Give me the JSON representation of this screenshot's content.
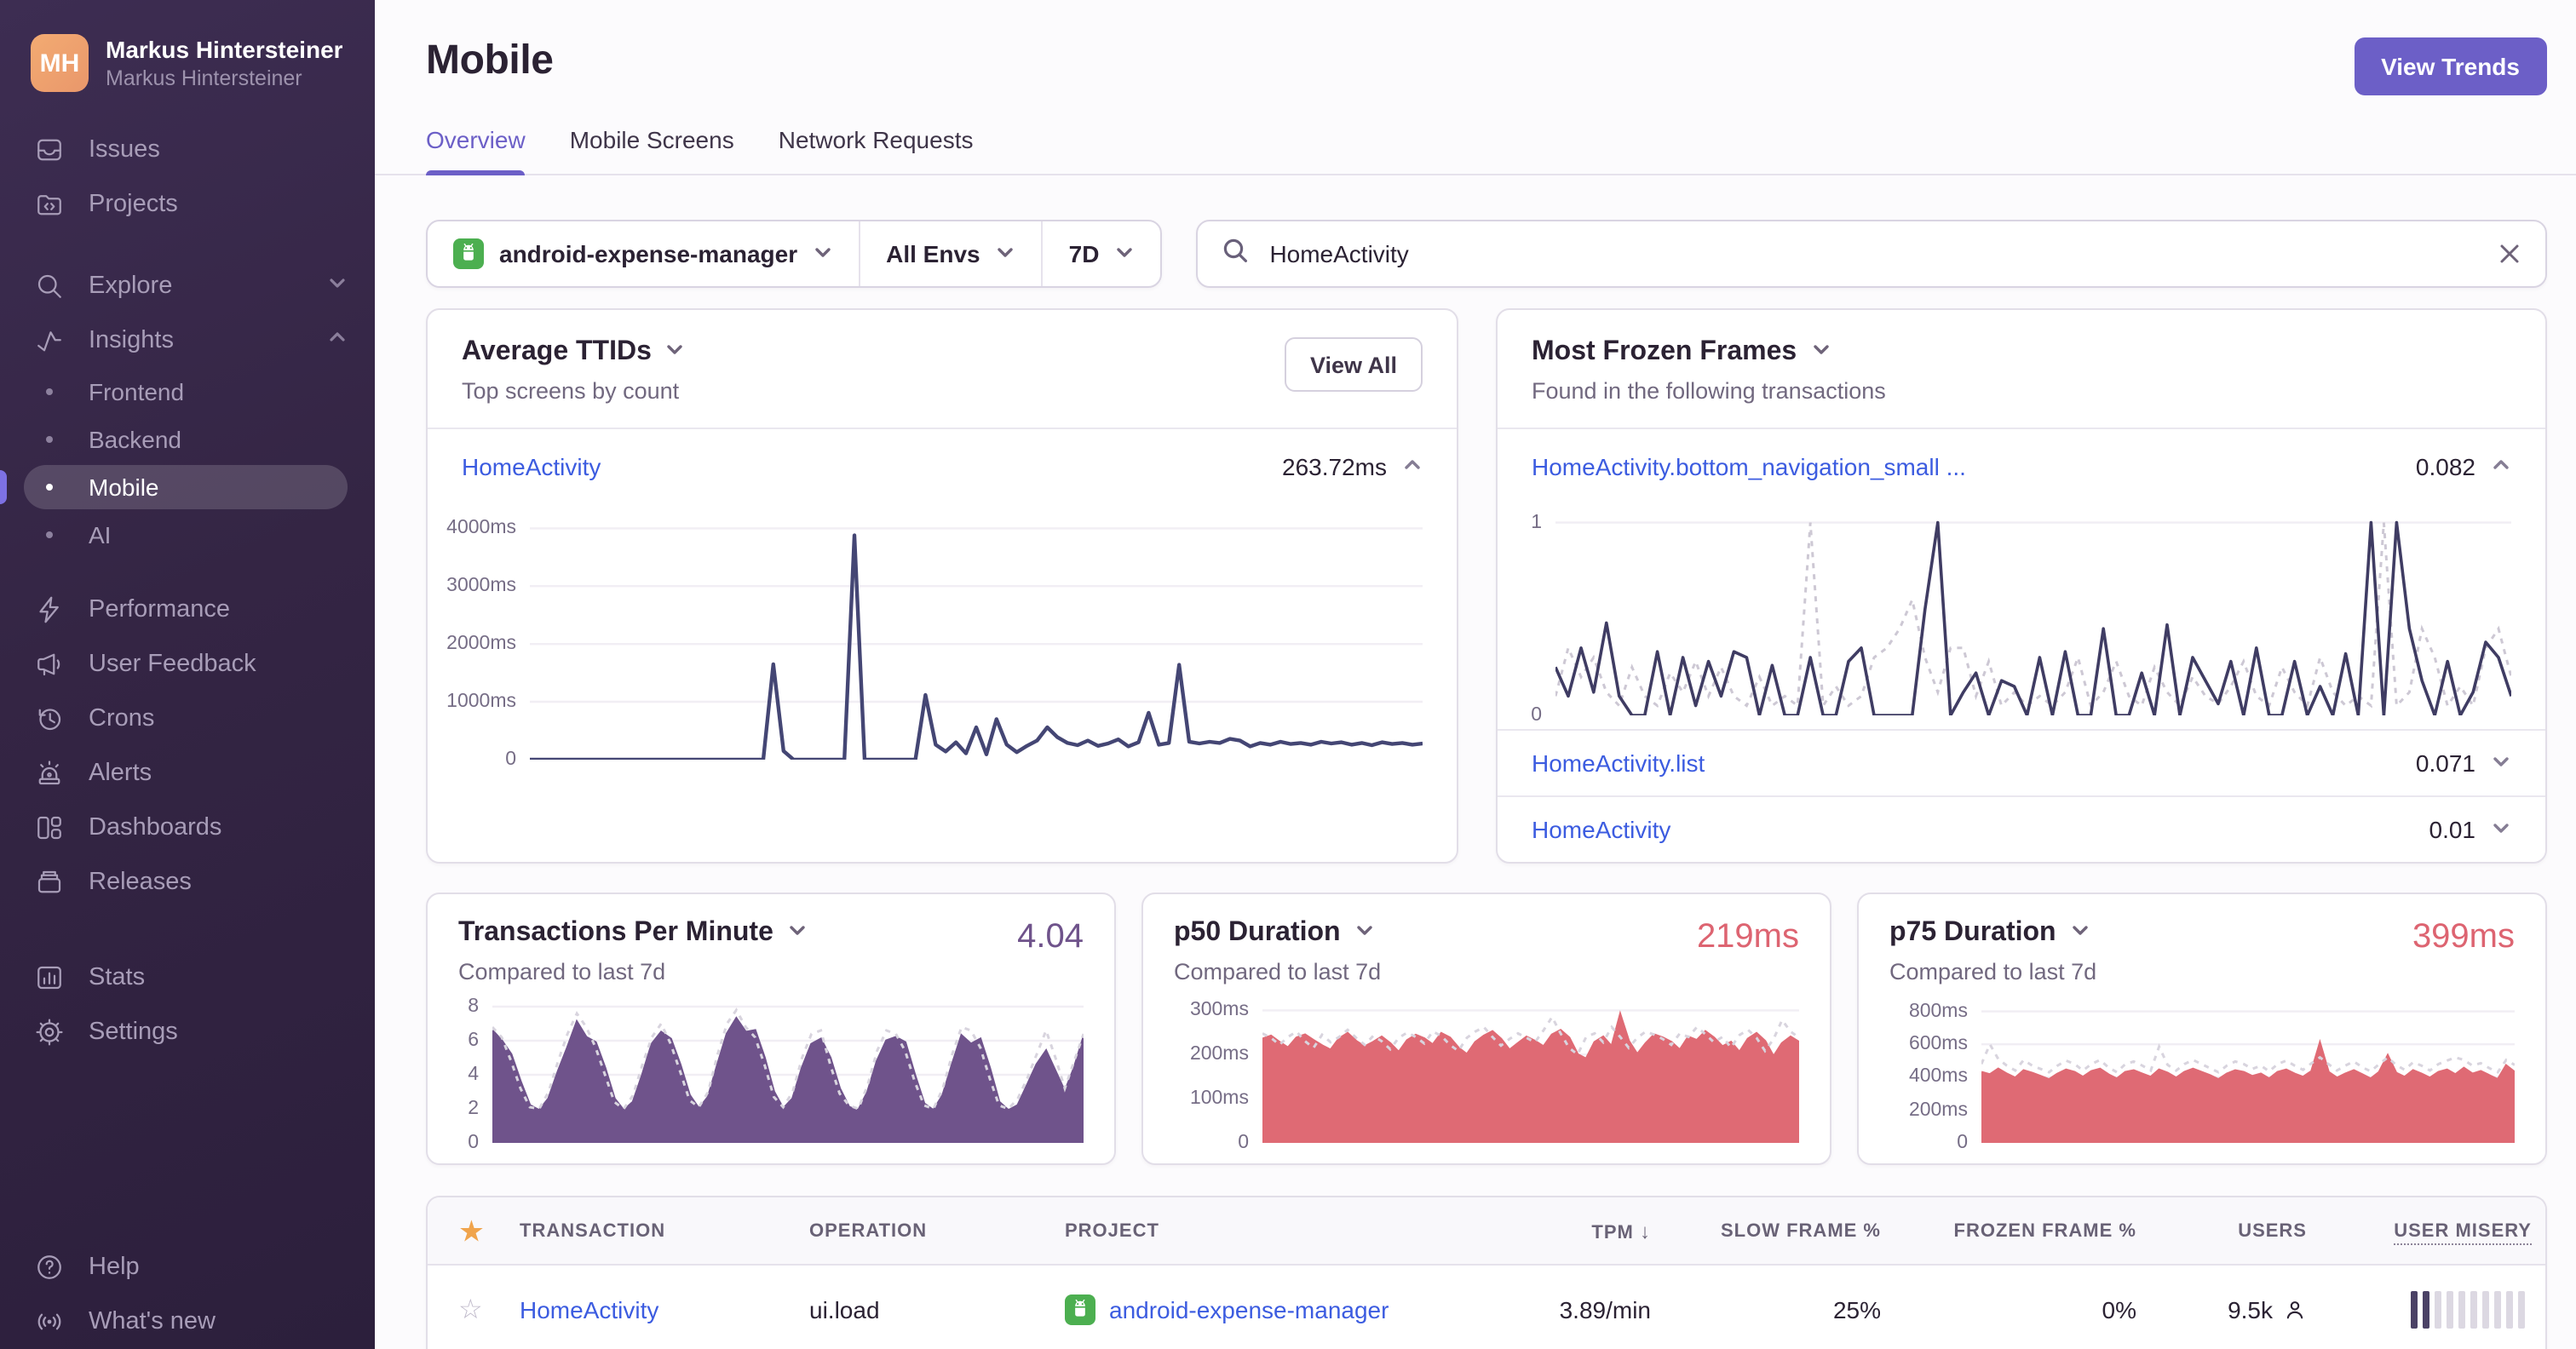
{
  "sidebar": {
    "avatar_initials": "MH",
    "org_name": "Markus Hintersteiner",
    "user_name": "Markus Hintersteiner",
    "items": [
      {
        "label": "Issues"
      },
      {
        "label": "Projects"
      },
      {
        "label": "Explore"
      },
      {
        "label": "Insights"
      },
      {
        "label": "Frontend"
      },
      {
        "label": "Backend"
      },
      {
        "label": "Mobile",
        "active": true
      },
      {
        "label": "AI"
      },
      {
        "label": "Performance"
      },
      {
        "label": "User Feedback"
      },
      {
        "label": "Crons"
      },
      {
        "label": "Alerts"
      },
      {
        "label": "Dashboards"
      },
      {
        "label": "Releases"
      },
      {
        "label": "Stats"
      },
      {
        "label": "Settings"
      },
      {
        "label": "Help"
      },
      {
        "label": "What's new"
      }
    ]
  },
  "header": {
    "title": "Mobile",
    "view_trends_label": "View Trends",
    "tabs": [
      {
        "label": "Overview",
        "active": true
      },
      {
        "label": "Mobile Screens"
      },
      {
        "label": "Network Requests"
      }
    ]
  },
  "filters": {
    "project": "android-expense-manager",
    "environment": "All Envs",
    "date_range": "7D",
    "search_value": "HomeActivity"
  },
  "cards": {
    "average_ttids": {
      "title": "Average TTIDs",
      "subtitle": "Top screens by count",
      "view_all_label": "View All",
      "rows": [
        {
          "name": "HomeActivity",
          "value": "263.72ms",
          "expanded": true
        }
      ]
    },
    "most_frozen_frames": {
      "title": "Most Frozen Frames",
      "subtitle": "Found in the following transactions",
      "rows": [
        {
          "name": "HomeActivity.bottom_navigation_small ...",
          "value": "0.082",
          "expanded": true
        },
        {
          "name": "HomeActivity.list",
          "value": "0.071",
          "expanded": false
        },
        {
          "name": "HomeActivity",
          "value": "0.01",
          "expanded": false
        }
      ]
    },
    "tpm": {
      "title": "Transactions Per Minute",
      "subtitle": "Compared to last 7d",
      "value": "4.04",
      "accent_color": "#6f538b"
    },
    "p50": {
      "title": "p50 Duration",
      "subtitle": "Compared to last 7d",
      "value": "219ms",
      "accent_color": "#dd6471"
    },
    "p75": {
      "title": "p75 Duration",
      "subtitle": "Compared to last 7d",
      "value": "399ms",
      "accent_color": "#dd6471"
    }
  },
  "table": {
    "columns": [
      "TRANSACTION",
      "OPERATION",
      "PROJECT",
      "TPM",
      "SLOW FRAME %",
      "FROZEN FRAME %",
      "USERS",
      "USER MISERY"
    ],
    "sorted_column": "TPM",
    "sort_direction": "desc",
    "row": {
      "transaction": "HomeActivity",
      "operation": "ui.load",
      "project": "android-expense-manager",
      "tpm": "3.89/min",
      "slow_frame_pct": "25%",
      "frozen_frame_pct": "0%",
      "users": "9.5k",
      "misery_filled": 2,
      "misery_total": 10
    }
  },
  "chart_data": [
    {
      "id": "ttid",
      "type": "line",
      "title": "Average TTIDs - HomeActivity",
      "ylabel": "ms",
      "color": "#444674",
      "line_width": 2.2,
      "ymax": 4300,
      "grid": true,
      "legend": "none",
      "ticks": [
        {
          "label": "4000ms",
          "value": 4000
        },
        {
          "label": "3000ms",
          "value": 3000
        },
        {
          "label": "2000ms",
          "value": 2000
        },
        {
          "label": "1000ms",
          "value": 1000
        },
        {
          "label": "0",
          "value": 0
        }
      ],
      "values": [
        0,
        0,
        0,
        0,
        0,
        0,
        0,
        0,
        0,
        0,
        0,
        0,
        0,
        0,
        0,
        0,
        0,
        0,
        0,
        0,
        0,
        0,
        0,
        0,
        1650,
        150,
        0,
        0,
        0,
        0,
        0,
        0,
        3880,
        0,
        0,
        0,
        0,
        0,
        0,
        1120,
        260,
        140,
        300,
        110,
        560,
        90,
        700,
        260,
        130,
        240,
        330,
        560,
        390,
        290,
        250,
        330,
        240,
        280,
        350,
        230,
        300,
        810,
        260,
        290,
        1640,
        310,
        280,
        310,
        290,
        360,
        330,
        230,
        290,
        260,
        310,
        270,
        290,
        260,
        310,
        280,
        300,
        260,
        290,
        250,
        300,
        270,
        290,
        260,
        280
      ]
    },
    {
      "id": "frozen",
      "type": "line",
      "title": "Most Frozen Frames - HomeActivity.bottom_navigation_small",
      "ylabel": "",
      "color": "#3f3c63",
      "compare_color": "#cdc8d4",
      "line_width": 1.8,
      "ymax": 1.06,
      "grid": true,
      "legend": "none",
      "ticks": [
        {
          "label": "1",
          "value": 1
        },
        {
          "label": "0",
          "value": 0
        }
      ],
      "values": [
        0.25,
        0.1,
        0.35,
        0.12,
        0.48,
        0.1,
        0,
        0,
        0.33,
        0,
        0.3,
        0.05,
        0.28,
        0.1,
        0.33,
        0.3,
        0,
        0.26,
        0,
        0,
        0.3,
        0,
        0,
        0.28,
        0.35,
        0,
        0,
        0,
        0,
        0.55,
        1.0,
        0,
        0.12,
        0.22,
        0,
        0.18,
        0.15,
        0,
        0.3,
        0,
        0.33,
        0,
        0,
        0.45,
        0,
        0,
        0.22,
        0,
        0.47,
        0,
        0.3,
        0.18,
        0.06,
        0.28,
        0,
        0.35,
        0,
        0,
        0.28,
        0,
        0.15,
        0,
        0.32,
        0,
        1.0,
        0,
        1.0,
        0.45,
        0.18,
        0,
        0.28,
        0,
        0.12,
        0.38,
        0.3,
        0.1
      ],
      "compare": [
        0.1,
        0.35,
        0.2,
        0.3,
        0.12,
        0.05,
        0.25,
        0.1,
        0.05,
        0.22,
        0.12,
        0.28,
        0.1,
        0.25,
        0.1,
        0.05,
        0.2,
        0.05,
        0.1,
        0.05,
        1.0,
        0.05,
        0.15,
        0.05,
        0.1,
        0.3,
        0.35,
        0.45,
        0.6,
        0.3,
        0.12,
        0.35,
        0.35,
        0.1,
        0.28,
        0.05,
        0.12,
        0.05,
        0.1,
        0.05,
        0.12,
        0.3,
        0.05,
        0.12,
        0.28,
        0.1,
        0.05,
        0.25,
        0.12,
        0.05,
        0.2,
        0.1,
        0.06,
        0.15,
        0.28,
        0.1,
        0.05,
        0.25,
        0.12,
        0.05,
        0.3,
        0.12,
        0.05,
        0.1,
        0.05,
        1.0,
        0.05,
        0.12,
        0.45,
        0.3,
        0.05,
        0.15,
        0.05,
        0.35,
        0.45,
        0.2
      ]
    },
    {
      "id": "tpm",
      "type": "area",
      "title": "Transactions Per Minute",
      "ylabel": "per minute",
      "color": "#6f538b",
      "compare_color": "#d8d4de",
      "ymax": 8.3,
      "grid": true,
      "legend": "none",
      "ticks": [
        {
          "label": "8",
          "value": 8
        },
        {
          "label": "6",
          "value": 6
        },
        {
          "label": "4",
          "value": 4
        },
        {
          "label": "2",
          "value": 2
        },
        {
          "label": "0",
          "value": 0
        }
      ],
      "values": [
        6.6,
        6.0,
        5.2,
        3.6,
        2.2,
        1.9,
        2.6,
        4.2,
        5.6,
        7.1,
        6.2,
        5.9,
        4.4,
        2.6,
        1.9,
        2.4,
        4.0,
        5.8,
        6.5,
        6.1,
        4.6,
        2.8,
        2.0,
        2.7,
        4.6,
        6.4,
        7.3,
        6.5,
        6.6,
        5.0,
        3.0,
        2.0,
        2.6,
        4.4,
        5.8,
        6.1,
        5.0,
        3.2,
        2.1,
        1.9,
        3.0,
        4.8,
        6.0,
        6.2,
        5.9,
        4.0,
        2.3,
        1.9,
        2.8,
        4.6,
        6.3,
        5.8,
        6.1,
        4.4,
        2.4,
        1.9,
        2.2,
        3.4,
        4.6,
        5.4,
        4.2,
        3.0,
        4.4,
        6.2
      ],
      "compare": [
        6.8,
        6.2,
        4.8,
        3.2,
        2.1,
        2.0,
        3.0,
        4.8,
        6.4,
        7.6,
        6.8,
        5.6,
        4.0,
        2.4,
        2.0,
        2.8,
        4.6,
        6.2,
        7.0,
        5.8,
        4.2,
        2.5,
        2.1,
        3.0,
        5.2,
        7.0,
        7.8,
        6.8,
        6.2,
        4.6,
        2.7,
        2.1,
        3.0,
        5.0,
        6.4,
        6.6,
        4.6,
        2.9,
        2.2,
        2.0,
        3.4,
        5.4,
        6.6,
        6.4,
        5.4,
        3.6,
        2.2,
        2.0,
        3.2,
        5.2,
        6.8,
        6.6,
        5.6,
        3.8,
        2.2,
        2.0,
        2.6,
        3.8,
        5.2,
        6.6,
        5.0,
        3.2,
        4.8,
        6.4
      ]
    },
    {
      "id": "p50",
      "type": "area",
      "title": "p50 Duration",
      "ylabel": "ms",
      "color": "#df6a74",
      "compare_color": "#d8d4de",
      "ymax": 320,
      "grid": true,
      "legend": "none",
      "ticks": [
        {
          "label": "300ms",
          "value": 300
        },
        {
          "label": "200ms",
          "value": 200
        },
        {
          "label": "100ms",
          "value": 100
        },
        {
          "label": "0",
          "value": 0
        }
      ],
      "values": [
        235,
        242,
        228,
        215,
        238,
        245,
        232,
        220,
        210,
        236,
        248,
        230,
        218,
        228,
        240,
        225,
        205,
        232,
        244,
        236,
        222,
        248,
        238,
        215,
        200,
        228,
        242,
        252,
        235,
        210,
        225,
        240,
        230,
        218,
        245,
        255,
        238,
        200,
        190,
        228,
        240,
        218,
        290,
        230,
        200,
        225,
        245,
        238,
        228,
        210,
        240,
        232,
        252,
        238,
        218,
        228,
        205,
        235,
        248,
        230,
        195,
        225,
        240,
        228
      ],
      "compare": [
        248,
        238,
        222,
        240,
        252,
        230,
        215,
        245,
        228,
        240,
        256,
        238,
        222,
        242,
        230,
        212,
        238,
        250,
        240,
        225,
        252,
        242,
        222,
        208,
        238,
        252,
        262,
        240,
        220,
        235,
        248,
        238,
        228,
        255,
        285,
        248,
        215,
        200,
        240,
        248,
        228,
        262,
        240,
        215,
        238,
        252,
        245,
        235,
        222,
        248,
        240,
        262,
        246,
        228,
        240,
        216,
        244,
        256,
        238,
        208,
        235,
        278,
        252,
        238
      ]
    },
    {
      "id": "p75",
      "type": "area",
      "title": "p75 Duration",
      "ylabel": "ms",
      "color": "#df6a74",
      "compare_color": "#d8d4de",
      "ymax": 860,
      "grid": true,
      "legend": "none",
      "ticks": [
        {
          "label": "800ms",
          "value": 800
        },
        {
          "label": "600ms",
          "value": 600
        },
        {
          "label": "400ms",
          "value": 400
        },
        {
          "label": "200ms",
          "value": 200
        },
        {
          "label": "0",
          "value": 0
        }
      ],
      "values": [
        430,
        415,
        450,
        420,
        395,
        440,
        425,
        405,
        385,
        420,
        445,
        430,
        400,
        435,
        450,
        415,
        390,
        430,
        440,
        420,
        400,
        445,
        425,
        395,
        430,
        450,
        430,
        410,
        385,
        420,
        440,
        430,
        405,
        420,
        390,
        430,
        445,
        420,
        400,
        435,
        605,
        430,
        395,
        420,
        440,
        415,
        390,
        430,
        530,
        425,
        400,
        440,
        420,
        395,
        430,
        445,
        415,
        455,
        420,
        435,
        410,
        385,
        470,
        430
      ],
      "compare": [
        480,
        600,
        510,
        470,
        440,
        505,
        470,
        450,
        430,
        470,
        500,
        480,
        440,
        480,
        505,
        460,
        430,
        480,
        495,
        470,
        440,
        585,
        475,
        440,
        480,
        505,
        480,
        455,
        430,
        470,
        495,
        480,
        450,
        470,
        435,
        480,
        500,
        470,
        445,
        485,
        520,
        480,
        440,
        470,
        495,
        460,
        435,
        480,
        520,
        475,
        445,
        490,
        470,
        440,
        480,
        500,
        520,
        505,
        470,
        485,
        455,
        430,
        505,
        475
      ]
    }
  ]
}
